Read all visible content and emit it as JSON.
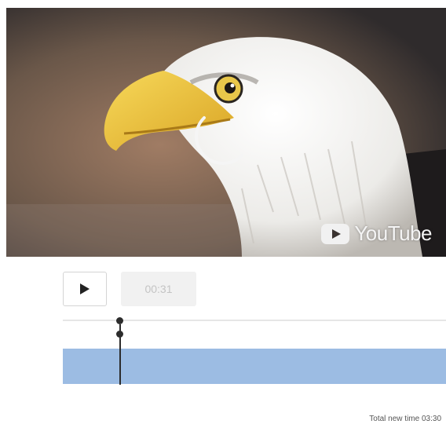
{
  "video": {
    "subject": "bald eagle",
    "watermark": "YouTube",
    "watermark_icon": "youtube-play-icon"
  },
  "controls": {
    "play_icon": "play-icon",
    "current_time": "00:31"
  },
  "timeline": {
    "bar_color": "#9cbce3",
    "playhead_position_fraction": 0.15
  },
  "footer": {
    "total_time": "Total new time 03:30"
  }
}
